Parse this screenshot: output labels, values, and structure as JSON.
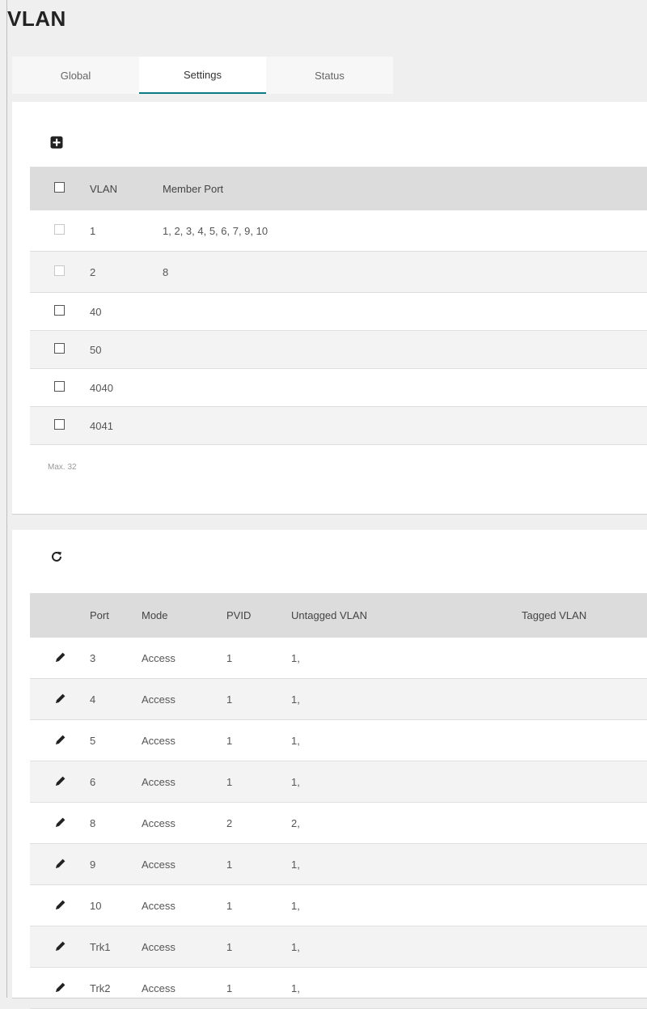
{
  "page": {
    "title": "VLAN"
  },
  "tabs": [
    {
      "label": "Global"
    },
    {
      "label": "Settings"
    },
    {
      "label": "Status"
    }
  ],
  "vlan_table": {
    "add_icon": "plus-square-icon",
    "headers": {
      "vlan": "VLAN",
      "member_port": "Member Port"
    },
    "rows": [
      {
        "vlan": "1",
        "member_port": "1, 2, 3, 4, 5, 6, 7, 9, 10"
      },
      {
        "vlan": "2",
        "member_port": "8"
      },
      {
        "vlan": "40",
        "member_port": ""
      },
      {
        "vlan": "50",
        "member_port": ""
      },
      {
        "vlan": "4040",
        "member_port": ""
      },
      {
        "vlan": "4041",
        "member_port": ""
      }
    ],
    "max_note": "Max. 32"
  },
  "port_table": {
    "refresh_icon": "refresh-icon",
    "headers": {
      "port": "Port",
      "mode": "Mode",
      "pvid": "PVID",
      "untagged": "Untagged VLAN",
      "tagged": "Tagged VLAN"
    },
    "rows": [
      {
        "port": "3",
        "mode": "Access",
        "pvid": "1",
        "untagged": "1,",
        "tagged": ""
      },
      {
        "port": "4",
        "mode": "Access",
        "pvid": "1",
        "untagged": "1,",
        "tagged": ""
      },
      {
        "port": "5",
        "mode": "Access",
        "pvid": "1",
        "untagged": "1,",
        "tagged": ""
      },
      {
        "port": "6",
        "mode": "Access",
        "pvid": "1",
        "untagged": "1,",
        "tagged": ""
      },
      {
        "port": "8",
        "mode": "Access",
        "pvid": "2",
        "untagged": "2,",
        "tagged": ""
      },
      {
        "port": "9",
        "mode": "Access",
        "pvid": "1",
        "untagged": "1,",
        "tagged": ""
      },
      {
        "port": "10",
        "mode": "Access",
        "pvid": "1",
        "untagged": "1,",
        "tagged": ""
      },
      {
        "port": "Trk1",
        "mode": "Access",
        "pvid": "1",
        "untagged": "1,",
        "tagged": ""
      },
      {
        "port": "Trk2",
        "mode": "Access",
        "pvid": "1",
        "untagged": "1,",
        "tagged": ""
      }
    ]
  },
  "colors": {
    "accent": "#0a7b84",
    "header_bg": "#dcdcdc",
    "page_bg": "#efefef"
  }
}
